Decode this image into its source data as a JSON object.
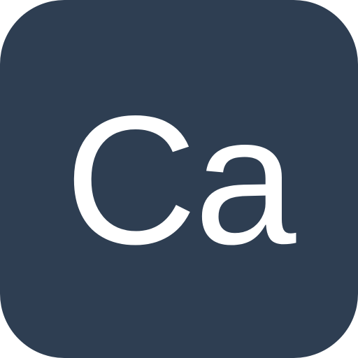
{
  "icon": {
    "text": "Ca",
    "background_color": "#2e3e52",
    "text_color": "#ffffff"
  }
}
